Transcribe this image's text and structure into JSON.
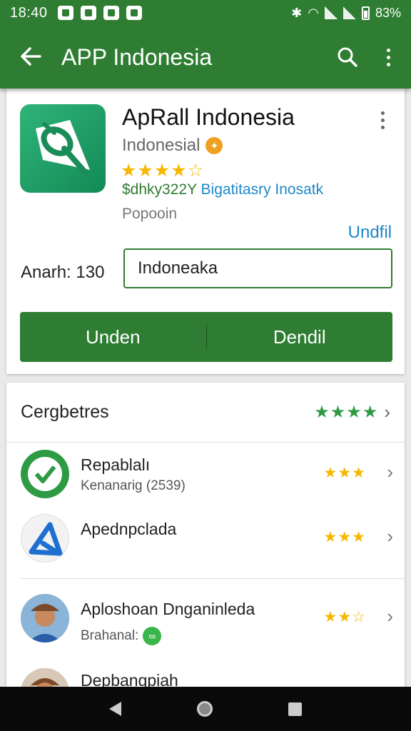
{
  "status_bar": {
    "time": "18:40",
    "battery": "83%"
  },
  "app_bar": {
    "title": "APP Indonesia"
  },
  "app": {
    "name": "ApRall Indonesia",
    "developer": "Indonesial",
    "rating_stars": "★★★★☆",
    "tagline_a": "$dhky322Y",
    "tagline_b": "Bigatitasry Inosatk",
    "category": "Popooin",
    "link": "Undfil",
    "amount_label": "Anarh: 130",
    "input_value": "Indoneaka",
    "button_left": "Unden",
    "button_right": "Dendil"
  },
  "section": {
    "title": "Cergbetres",
    "stars": "★★★★"
  },
  "list": [
    {
      "name": "Repablalı",
      "sub": "Kenanarig (2539)",
      "stars": "★★★"
    },
    {
      "name": "Apednpclada",
      "sub": "",
      "stars": "★★★"
    },
    {
      "name": "Aploshoan Dnganinleda",
      "sub": "Brahanal:",
      "stars": "★★☆"
    },
    {
      "name": "Depbangpiah",
      "sub": "",
      "stars": ""
    }
  ],
  "colors": {
    "primary": "#2e7d32",
    "link": "#1e88c8",
    "star": "#f5b700"
  }
}
